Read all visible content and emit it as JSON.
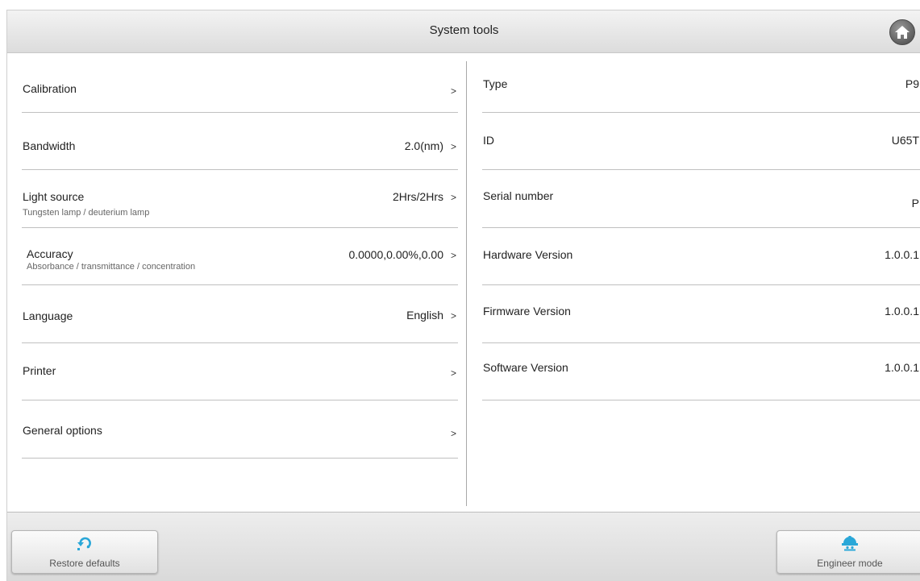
{
  "header": {
    "title": "System tools",
    "home_icon": "home-icon"
  },
  "settings": [
    {
      "label": "Calibration",
      "sublabel": "",
      "value": "",
      "chevron": ">"
    },
    {
      "label": "Bandwidth",
      "sublabel": "",
      "value": "2.0(nm)",
      "chevron": ">"
    },
    {
      "label": "Light source",
      "sublabel": "Tungsten lamp / deuterium lamp",
      "value": "2Hrs/2Hrs",
      "chevron": ">"
    },
    {
      "label": "Accuracy",
      "sublabel": "Absorbance / transmittance / concentration",
      "value": "0.0000,0.00%,0.00",
      "chevron": ">"
    },
    {
      "label": "Language",
      "sublabel": "",
      "value": "English",
      "chevron": ">"
    },
    {
      "label": "Printer",
      "sublabel": "",
      "value": "",
      "chevron": ">"
    },
    {
      "label": "General options",
      "sublabel": "",
      "value": "",
      "chevron": ">"
    }
  ],
  "info": [
    {
      "label": "Type",
      "value": "P9"
    },
    {
      "label": "ID",
      "value": "U65T"
    },
    {
      "label": "Serial number",
      "value": "P"
    },
    {
      "label": "Hardware Version",
      "value": "1.0.0.1"
    },
    {
      "label": "Firmware Version",
      "value": "1.0.0.1"
    },
    {
      "label": "Software Version",
      "value": "1.0.0.1"
    }
  ],
  "footer": {
    "restore_label": "Restore defaults",
    "engineer_label": "Engineer mode"
  },
  "colors": {
    "accent": "#2aa7d8",
    "header_bg": "#e6e6e6",
    "divider": "#c0c0c0"
  }
}
